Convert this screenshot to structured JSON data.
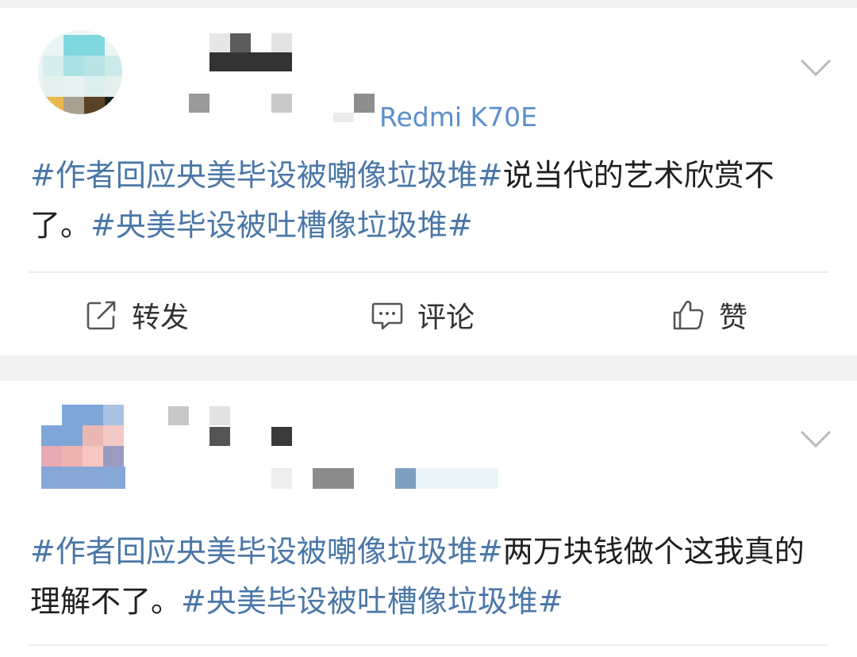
{
  "posts": [
    {
      "device": "Redmi K70E",
      "text_parts": [
        {
          "type": "tag",
          "text": "#作者回应央美毕设被嘲像垃圾堆#"
        },
        {
          "type": "plain",
          "text": "说当代的艺术欣赏不了。"
        },
        {
          "type": "tag",
          "text": "#央美毕设被吐槽像垃圾堆#"
        }
      ],
      "actions": {
        "repost": "转发",
        "comment": "评论",
        "like": "赞"
      }
    },
    {
      "text_parts": [
        {
          "type": "tag",
          "text": "#作者回应央美毕设被嘲像垃圾堆#"
        },
        {
          "type": "plain",
          "text": "两万块钱做个这我真的理解不了。"
        },
        {
          "type": "tag",
          "text": "#央美毕设被吐槽像垃圾堆#"
        }
      ]
    }
  ],
  "icons": {
    "avatar_1": "pixelated-avatar",
    "avatar_2": "pixelated-avatar",
    "more": "chevron-down-icon",
    "repost": "edit-share-icon",
    "comment": "comment-bubble-icon",
    "like": "thumbs-up-icon"
  },
  "colors": {
    "tag": "#4b77a8",
    "device": "#5b8fcc",
    "text": "#1f1f1f",
    "background": "#f1f1f1"
  }
}
